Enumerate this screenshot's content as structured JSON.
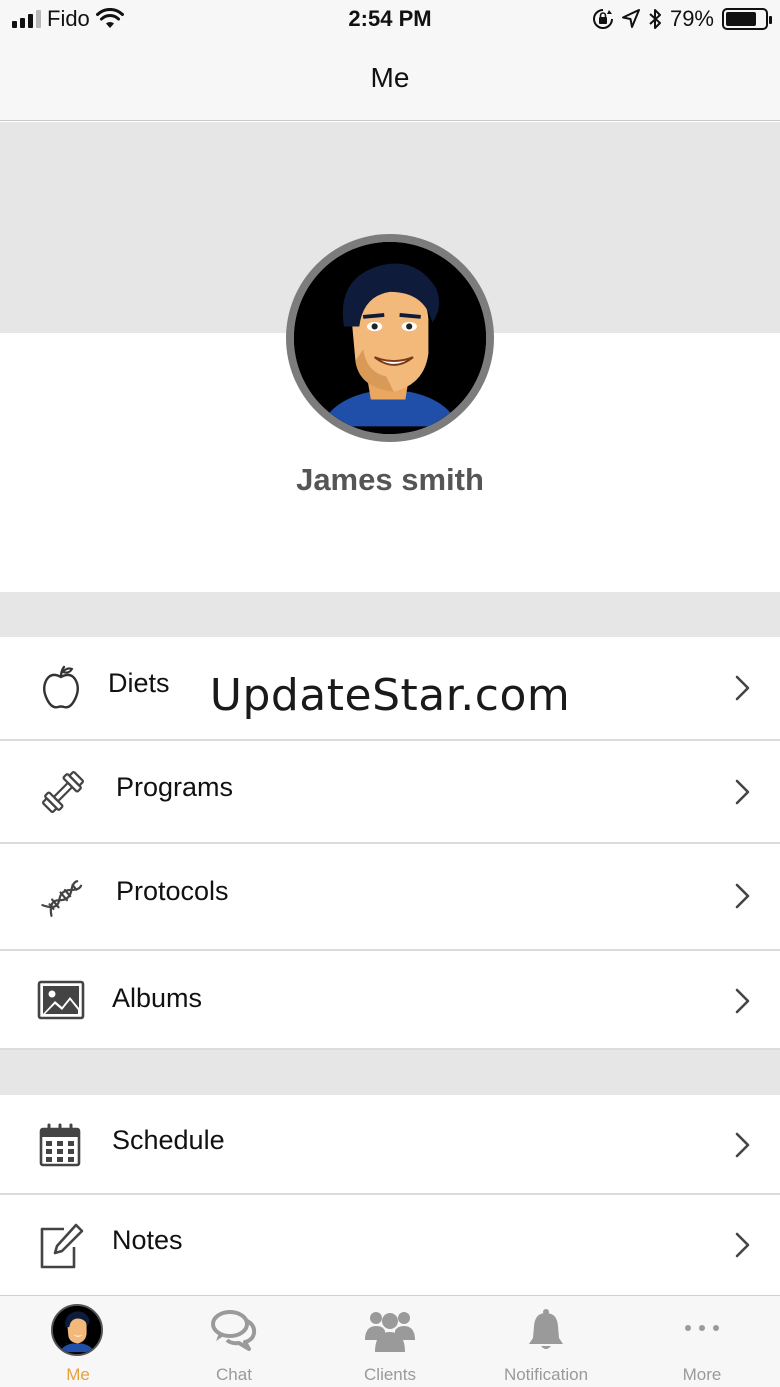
{
  "status_bar": {
    "carrier": "Fido",
    "time": "2:54 PM",
    "battery_percent": "79%",
    "battery_level": 0.79,
    "icons": [
      "signal-icon",
      "wifi-icon",
      "orientation-lock-icon",
      "location-icon",
      "bluetooth-icon",
      "battery-icon"
    ]
  },
  "nav": {
    "title": "Me"
  },
  "profile": {
    "name": "James smith"
  },
  "watermark": "UpdateStar.com",
  "menu_group_1": [
    {
      "label": "Diets",
      "icon": "apple-icon"
    },
    {
      "label": "Programs",
      "icon": "dumbbell-icon"
    },
    {
      "label": "Protocols",
      "icon": "dna-icon"
    },
    {
      "label": "Albums",
      "icon": "image-icon"
    }
  ],
  "menu_group_2": [
    {
      "label": "Schedule",
      "icon": "calendar-icon"
    },
    {
      "label": "Notes",
      "icon": "edit-note-icon"
    }
  ],
  "tabs": [
    {
      "label": "Me",
      "icon": "avatar-icon",
      "active": true
    },
    {
      "label": "Chat",
      "icon": "chat-bubbles-icon",
      "active": false
    },
    {
      "label": "Clients",
      "icon": "group-icon",
      "active": false
    },
    {
      "label": "Notification",
      "icon": "bell-icon",
      "active": false
    },
    {
      "label": "More",
      "icon": "ellipsis-icon",
      "active": false
    }
  ],
  "colors": {
    "active_tab": "#e8a13a",
    "inactive_tab": "#9a9a9a",
    "section_gap": "#e6e6e6",
    "bar_background": "#f7f7f7"
  }
}
